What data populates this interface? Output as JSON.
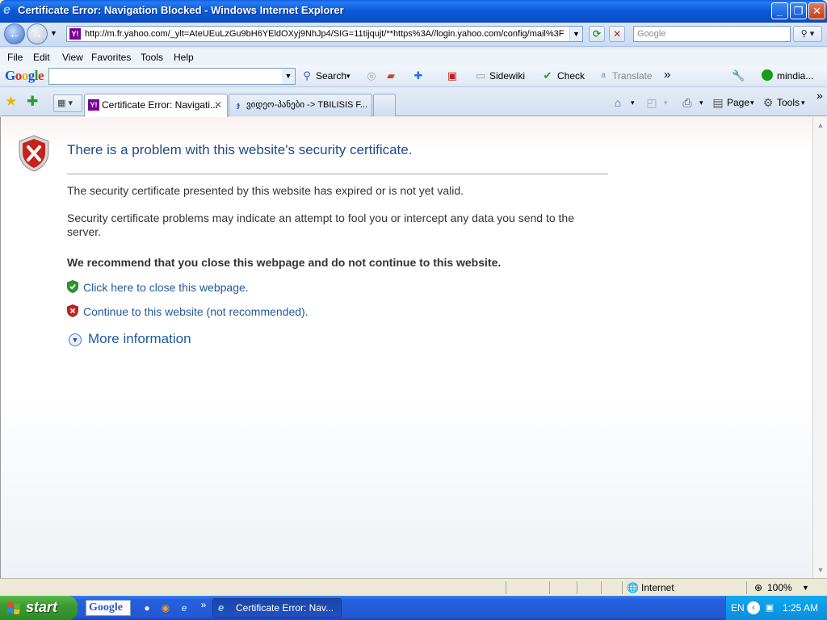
{
  "window": {
    "title": "Certificate Error: Navigation Blocked - Windows Internet Explorer",
    "buttons": {
      "minimize": "_",
      "maximize": "❐",
      "close": "✕"
    }
  },
  "address_bar": {
    "url": "http://m.fr.yahoo.com/_ylt=AteUEuLzGu9bH6YEldOXyj9NhJp4/SIG=11tijqujt/**https%3A//login.yahoo.com/config/mail%3F",
    "favicon": "Y!",
    "search_placeholder": "Google"
  },
  "menu": {
    "items": [
      "File",
      "Edit",
      "View",
      "Favorites",
      "Tools",
      "Help"
    ]
  },
  "google_toolbar": {
    "logo": "Google",
    "search_value": "",
    "search_label": "Search",
    "sidewiki_label": "Sidewiki",
    "check_label": "Check",
    "translate_label": "Translate",
    "more": "»",
    "user_label": "mindia..."
  },
  "tabs": [
    {
      "label": "Certificate Error: Navigati...",
      "favicon": "Y!",
      "active": true,
      "close": "✕"
    },
    {
      "label": "ვიდეო-პანები -> TBILISIS F...",
      "favicon": "ჯ",
      "active": false
    }
  ],
  "command_bar": {
    "page_label": "Page",
    "tools_label": "Tools",
    "more": "»"
  },
  "page": {
    "heading": "There is a problem with this website's security certificate.",
    "para1": "The security certificate presented by this website has expired or is not yet valid.",
    "para2": "Security certificate problems may indicate an attempt to fool you or intercept any data you send to the server.",
    "recommend": "We recommend that you close this webpage and do not continue to this website.",
    "close_link": "Click here to close this webpage.",
    "continue_link": "Continue to this website (not recommended).",
    "more_info": "More information"
  },
  "status_bar": {
    "zone": "Internet",
    "zoom": "100%"
  },
  "taskbar": {
    "start_label": "start",
    "google_label": "Google",
    "task_label": "Certificate Error: Nav...",
    "language": "EN",
    "clock": "1:25 AM",
    "chevron": "»"
  },
  "colors": {
    "heading": "#1f4a8a",
    "link": "#1f5a9a",
    "titlebar": "#0a5fe6",
    "start_green": "#3c9a32"
  }
}
